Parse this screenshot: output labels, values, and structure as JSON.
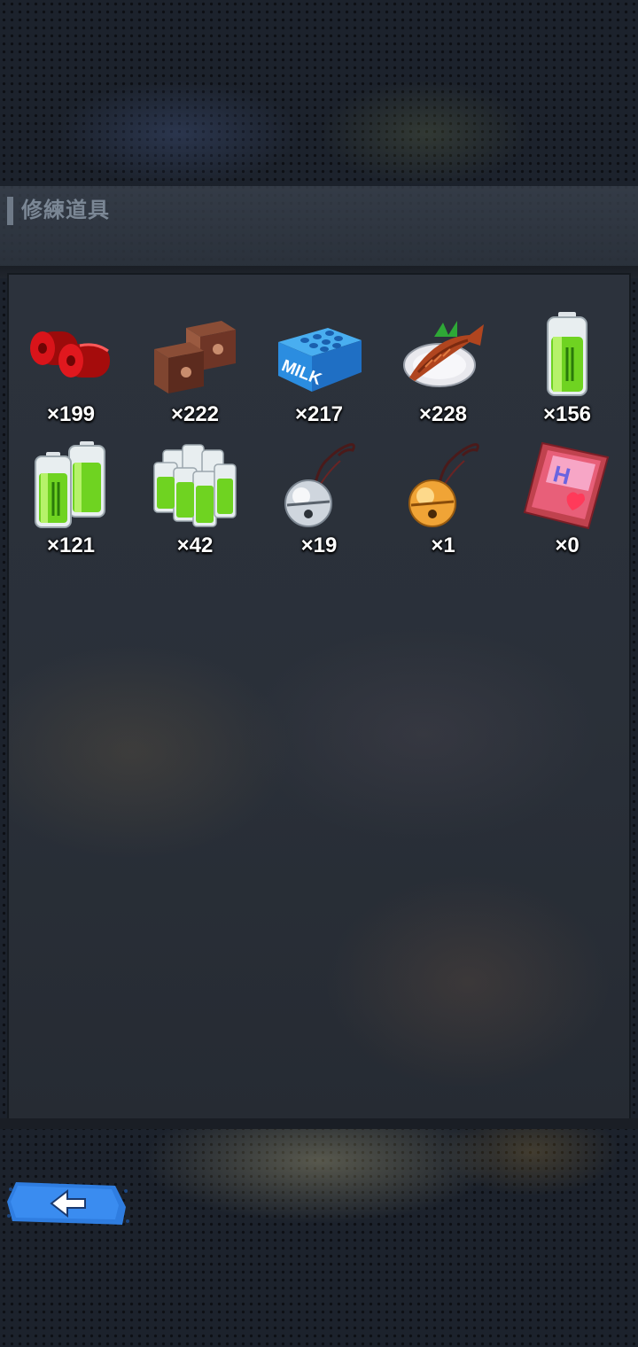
{
  "header": {
    "title": "修練道具"
  },
  "items": [
    {
      "icon": "red-weights-icon",
      "count": "×199"
    },
    {
      "icon": "bricks-icon",
      "count": "×222"
    },
    {
      "icon": "milk-crate-icon",
      "count": "×217"
    },
    {
      "icon": "grilled-fish-icon",
      "count": "×228"
    },
    {
      "icon": "battery-icon",
      "count": "×156"
    },
    {
      "icon": "double-battery-icon",
      "count": "×121"
    },
    {
      "icon": "battery-pack-icon",
      "count": "×42"
    },
    {
      "icon": "silver-bell-icon",
      "count": "×19"
    },
    {
      "icon": "gold-bell-icon",
      "count": "×1"
    },
    {
      "icon": "magazine-icon",
      "count": "×0"
    }
  ],
  "nav": {
    "back_icon": "back-arrow-icon"
  },
  "colors": {
    "accent": "#2f7de0",
    "count_text": "#ffffff",
    "header_text": "#7b8795"
  }
}
